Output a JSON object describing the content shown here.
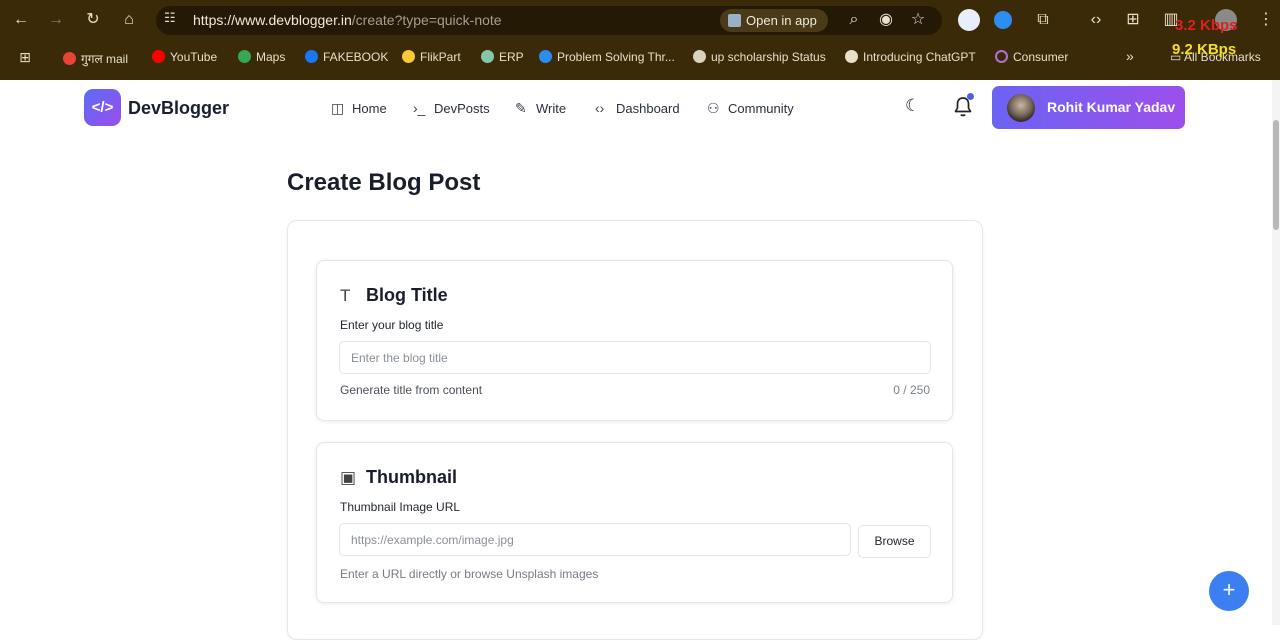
{
  "browser": {
    "url_host": "https://www.devblogger.in",
    "url_path": "/create?type=quick-note",
    "open_in_app": "Open in app",
    "speed_up": "3.2 Kbps",
    "speed_down": "9.2 KBps",
    "bookmarks": [
      {
        "label": "गुगल mail",
        "color": "#ea4335"
      },
      {
        "label": "YouTube",
        "color": "#ff0000"
      },
      {
        "label": "Maps",
        "color": "#34a853"
      },
      {
        "label": "FAKEBOOK",
        "color": "#1877f2"
      },
      {
        "label": "FlikPart",
        "color": "#f9c935"
      },
      {
        "label": "ERP",
        "color": "#86c6a8"
      },
      {
        "label": "Problem Solving Thr...",
        "color": "#2d8cf0"
      },
      {
        "label": "up scholarship Status",
        "color": "#d8d2c0"
      },
      {
        "label": "Introducing ChatGPT",
        "color": "#e8e0c8"
      },
      {
        "label": "Consumer",
        "color": "#b070d8"
      }
    ],
    "all_bookmarks": "All Bookmarks"
  },
  "nav": {
    "brand": "DevBlogger",
    "logo_glyph": "</>",
    "items": [
      {
        "label": "Home",
        "icon": "layout-icon"
      },
      {
        "label": "DevPosts",
        "icon": "terminal-icon"
      },
      {
        "label": "Write",
        "icon": "pen-icon"
      },
      {
        "label": "Dashboard",
        "icon": "code-icon"
      },
      {
        "label": "Community",
        "icon": "users-icon"
      }
    ],
    "user_name": "Rohit Kumar Yadav"
  },
  "page": {
    "title": "Create Blog Post",
    "title_card": {
      "heading": "Blog Title",
      "label": "Enter your blog title",
      "placeholder": "Enter the blog title",
      "hint": "Generate title from content",
      "counter": "0 / 250"
    },
    "thumbnail_card": {
      "heading": "Thumbnail",
      "label": "Thumbnail Image URL",
      "placeholder": "https://example.com/image.jpg",
      "browse": "Browse",
      "hint": "Enter a URL directly or browse Unsplash images"
    },
    "fab": "+"
  }
}
